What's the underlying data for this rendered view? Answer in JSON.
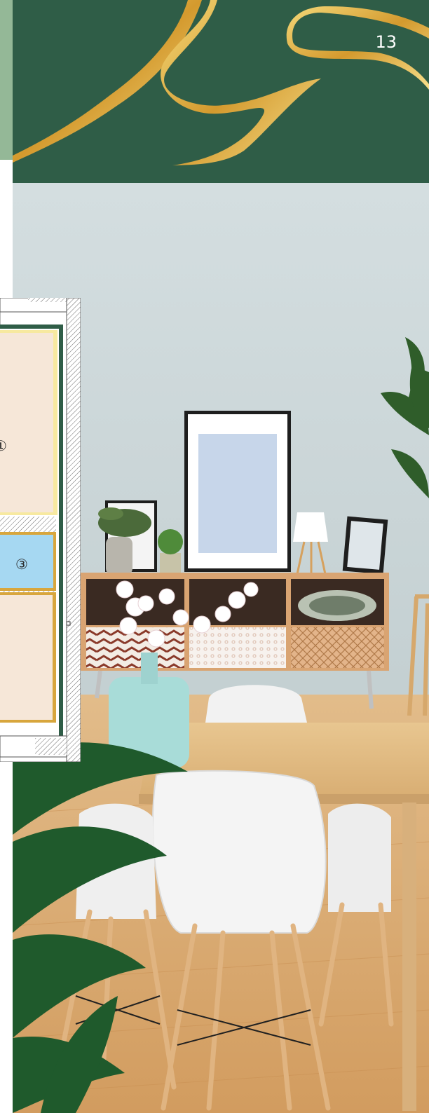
{
  "page": {
    "number": "13"
  },
  "header": {
    "icon": "gold-swirl-ornament"
  },
  "colors": {
    "header_green": "#2f5d47",
    "strip_sage": "#94b897",
    "gold": "#d8a63d",
    "wall_blue_gray": "#c9d5d7",
    "floor_oak": "#d9b07c",
    "room_beige": "#f6e7d8",
    "room_blue": "#a6d8f2"
  },
  "floorplan": {
    "rooms": [
      {
        "marker": "①"
      },
      {
        "marker": "③"
      }
    ]
  }
}
